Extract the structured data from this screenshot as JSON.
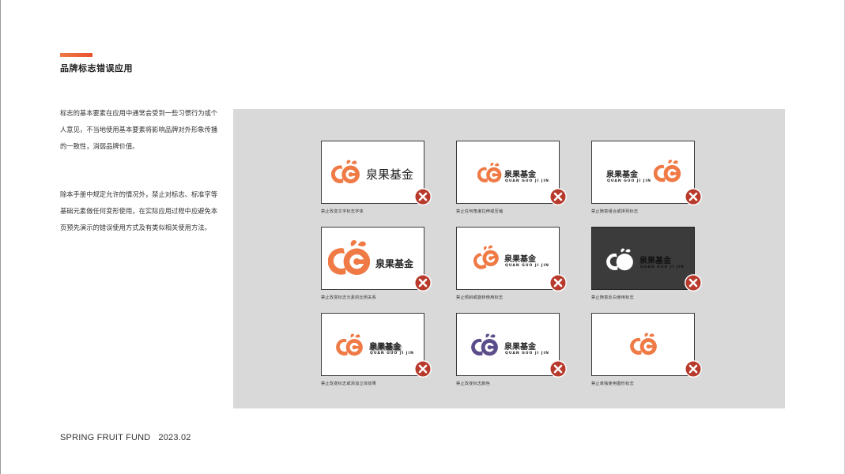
{
  "page": {
    "title": "品牌标志错误应用",
    "paragraph1": "标志的基本要素在应用中通常会受到一些习惯行为或个人意见，不当地使用基本要素将影响品牌对外形象传播的一致性，消弱品牌价值。",
    "paragraph2": "除本手册中规定允许的情况外，禁止对标志、标准字等基础元素做任何变形使用，在实际应用过程中应避免本页预先演示的错误使用方式及有类似相关使用方法。",
    "footer_brand": "SPRING FRUIT FUND",
    "footer_date": "2023.02"
  },
  "brand": {
    "wordmark_regular": "泉果基金",
    "wordmark_bold": "泉果基金",
    "pinyin": "QUAN GUO JI JIN"
  },
  "colors": {
    "orange": "#f07a45",
    "orange_dark": "#e65a2c",
    "green_leaf": "#e9512e",
    "purple": "#5a4d8a",
    "error_red": "#b83a2c",
    "dark_bg": "#3b3b3b"
  },
  "examples": [
    {
      "caption": "禁止改变文字标志字体"
    },
    {
      "caption": "禁止任何角度拉伸或压缩"
    },
    {
      "caption": "禁止随意组合或排列标志"
    },
    {
      "caption": "禁止改变标志元素的比例关系"
    },
    {
      "caption": "禁止倾斜或旋转使用标志"
    },
    {
      "caption": "禁止随意反白使用标志"
    },
    {
      "caption": "禁止改变标志或添加立体效果"
    },
    {
      "caption": "禁止改变标志颜色"
    },
    {
      "caption": "禁止单独使用图形标志"
    }
  ],
  "icons": {
    "error": "x-circle-icon",
    "logo": "fruit-logo-icon"
  }
}
